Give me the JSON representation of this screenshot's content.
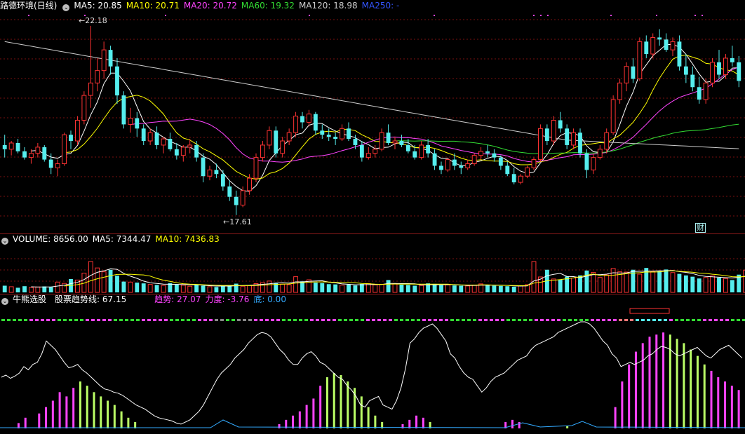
{
  "price_panel": {
    "title": "路德环境(日线)",
    "ma": [
      {
        "label": "MA5: 20.85",
        "color": "#ffffff"
      },
      {
        "label": "MA10: 20.71",
        "color": "#ffff00"
      },
      {
        "label": "MA20: 20.72",
        "color": "#ff44ff"
      },
      {
        "label": "MA60: 19.32",
        "color": "#33dd33"
      },
      {
        "label": "MA120: 18.98",
        "color": "#cccccc"
      },
      {
        "label": "MA250: -",
        "color": "#3355ff"
      }
    ],
    "high_label": "22.18",
    "low_label": "17.61",
    "finance_badge": "财"
  },
  "volume_panel": {
    "items": [
      {
        "label": "VOLUME: 8656.00",
        "color": "#ffffff"
      },
      {
        "label": "MA5: 7344.47",
        "color": "#ffffff"
      },
      {
        "label": "MA10: 7436.83",
        "color": "#ffff00"
      }
    ]
  },
  "indicator_panel": {
    "items": [
      {
        "label": "牛熊选股",
        "color": "#ffffff"
      },
      {
        "label": "股票趋势线: 67.15",
        "color": "#ffffff"
      },
      {
        "label": "趋势: 27.07",
        "color": "#ff44ff"
      },
      {
        "label": "力度: -3.76",
        "color": "#ff44ff"
      },
      {
        "label": "底: 0.00",
        "color": "#33aaff"
      }
    ]
  },
  "colors": {
    "up": "#ff3333",
    "down": "#55eeee",
    "grid": "#7a1010"
  },
  "chart_data": {
    "type": "candlestick",
    "ylim": [
      17.3,
      22.5
    ],
    "candles": [
      [
        19.3,
        19.55,
        19.0,
        19.2
      ],
      [
        19.2,
        19.4,
        19.05,
        19.35
      ],
      [
        19.35,
        19.45,
        19.1,
        19.15
      ],
      [
        19.15,
        19.25,
        18.95,
        19.0
      ],
      [
        19.0,
        19.2,
        18.85,
        19.1
      ],
      [
        19.1,
        19.35,
        19.0,
        19.25
      ],
      [
        19.25,
        19.3,
        18.9,
        18.95
      ],
      [
        18.95,
        19.1,
        18.6,
        18.75
      ],
      [
        18.75,
        18.95,
        18.55,
        18.85
      ],
      [
        18.85,
        19.6,
        18.8,
        19.55
      ],
      [
        19.55,
        19.65,
        19.2,
        19.4
      ],
      [
        19.4,
        20.0,
        19.3,
        19.9
      ],
      [
        19.9,
        20.6,
        19.8,
        20.5
      ],
      [
        20.5,
        22.18,
        20.2,
        20.8
      ],
      [
        20.8,
        21.4,
        20.6,
        21.1
      ],
      [
        21.1,
        21.8,
        20.9,
        21.6
      ],
      [
        21.6,
        21.7,
        21.0,
        21.2
      ],
      [
        21.2,
        21.4,
        20.3,
        20.5
      ],
      [
        20.5,
        20.6,
        19.7,
        19.8
      ],
      [
        19.8,
        20.2,
        19.6,
        19.95
      ],
      [
        19.95,
        20.1,
        19.5,
        19.7
      ],
      [
        19.7,
        19.8,
        19.3,
        19.4
      ],
      [
        19.4,
        19.7,
        19.3,
        19.6
      ],
      [
        19.6,
        19.75,
        19.2,
        19.3
      ],
      [
        19.3,
        19.5,
        19.1,
        19.45
      ],
      [
        19.45,
        19.6,
        19.15,
        19.2
      ],
      [
        19.2,
        19.35,
        18.95,
        19.05
      ],
      [
        19.05,
        19.3,
        18.9,
        19.25
      ],
      [
        19.25,
        19.45,
        19.1,
        19.3
      ],
      [
        19.3,
        19.4,
        18.9,
        19.0
      ],
      [
        19.0,
        19.1,
        18.4,
        18.55
      ],
      [
        18.55,
        18.8,
        18.45,
        18.7
      ],
      [
        18.7,
        18.85,
        18.5,
        18.6
      ],
      [
        18.6,
        18.7,
        18.2,
        18.3
      ],
      [
        18.3,
        18.45,
        17.95,
        18.05
      ],
      [
        18.05,
        18.2,
        17.61,
        17.85
      ],
      [
        17.85,
        18.3,
        17.8,
        18.2
      ],
      [
        18.2,
        18.6,
        18.1,
        18.5
      ],
      [
        18.5,
        19.1,
        18.4,
        19.0
      ],
      [
        19.0,
        19.4,
        18.9,
        19.3
      ],
      [
        19.3,
        19.75,
        19.2,
        19.65
      ],
      [
        19.65,
        19.75,
        19.0,
        19.1
      ],
      [
        19.1,
        19.5,
        19.0,
        19.4
      ],
      [
        19.4,
        19.7,
        19.3,
        19.6
      ],
      [
        19.6,
        20.1,
        19.5,
        20.0
      ],
      [
        20.0,
        20.1,
        19.7,
        19.85
      ],
      [
        19.85,
        20.15,
        19.75,
        20.05
      ],
      [
        20.05,
        20.1,
        19.55,
        19.65
      ],
      [
        19.65,
        19.8,
        19.45,
        19.55
      ],
      [
        19.55,
        19.7,
        19.4,
        19.5
      ],
      [
        19.5,
        19.6,
        19.3,
        19.45
      ],
      [
        19.45,
        19.8,
        19.4,
        19.7
      ],
      [
        19.7,
        19.85,
        19.4,
        19.45
      ],
      [
        19.45,
        19.55,
        19.2,
        19.3
      ],
      [
        19.3,
        19.4,
        18.9,
        19.0
      ],
      [
        19.0,
        19.25,
        18.95,
        19.1
      ],
      [
        19.1,
        19.3,
        19.0,
        19.2
      ],
      [
        19.2,
        19.7,
        19.15,
        19.6
      ],
      [
        19.6,
        19.8,
        19.3,
        19.35
      ],
      [
        19.35,
        19.5,
        19.2,
        19.4
      ],
      [
        19.4,
        19.55,
        19.25,
        19.3
      ],
      [
        19.3,
        19.45,
        19.1,
        19.15
      ],
      [
        19.15,
        19.3,
        18.95,
        19.0
      ],
      [
        19.0,
        19.4,
        18.95,
        19.3
      ],
      [
        19.3,
        19.45,
        19.0,
        19.1
      ],
      [
        19.1,
        19.2,
        18.7,
        18.8
      ],
      [
        18.8,
        18.9,
        18.6,
        18.7
      ],
      [
        18.7,
        19.0,
        18.65,
        18.95
      ],
      [
        18.95,
        19.1,
        18.7,
        18.8
      ],
      [
        18.8,
        18.9,
        18.6,
        18.75
      ],
      [
        18.75,
        18.95,
        18.7,
        18.85
      ],
      [
        18.85,
        19.1,
        18.8,
        19.05
      ],
      [
        19.05,
        19.25,
        18.95,
        19.15
      ],
      [
        19.15,
        19.3,
        19.0,
        19.1
      ],
      [
        19.1,
        19.2,
        18.9,
        19.0
      ],
      [
        19.0,
        19.05,
        18.7,
        18.8
      ],
      [
        18.8,
        18.9,
        18.55,
        18.6
      ],
      [
        18.6,
        18.75,
        18.35,
        18.4
      ],
      [
        18.4,
        18.6,
        18.35,
        18.55
      ],
      [
        18.55,
        18.8,
        18.5,
        18.75
      ],
      [
        18.75,
        19.0,
        18.7,
        18.95
      ],
      [
        18.95,
        19.8,
        18.9,
        19.7
      ],
      [
        19.7,
        19.8,
        19.3,
        19.4
      ],
      [
        19.4,
        20.0,
        19.3,
        19.9
      ],
      [
        19.9,
        20.1,
        19.6,
        19.7
      ],
      [
        19.7,
        19.8,
        19.2,
        19.3
      ],
      [
        19.3,
        19.7,
        19.2,
        19.6
      ],
      [
        19.6,
        19.7,
        19.0,
        19.1
      ],
      [
        19.1,
        19.2,
        18.5,
        18.7
      ],
      [
        18.7,
        19.1,
        18.6,
        19.0
      ],
      [
        19.0,
        19.3,
        18.95,
        19.2
      ],
      [
        19.2,
        19.7,
        19.1,
        19.6
      ],
      [
        19.6,
        20.5,
        19.55,
        20.4
      ],
      [
        20.4,
        20.9,
        20.3,
        20.8
      ],
      [
        20.8,
        21.3,
        20.6,
        21.2
      ],
      [
        21.2,
        21.4,
        20.8,
        20.9
      ],
      [
        20.9,
        21.9,
        20.85,
        21.8
      ],
      [
        21.8,
        21.95,
        21.4,
        21.5
      ],
      [
        21.5,
        22.0,
        21.4,
        21.9
      ],
      [
        21.9,
        22.1,
        21.7,
        21.85
      ],
      [
        21.85,
        22.0,
        21.55,
        21.6
      ],
      [
        21.6,
        21.9,
        21.45,
        21.8
      ],
      [
        21.8,
        21.95,
        21.1,
        21.2
      ],
      [
        21.2,
        21.5,
        20.8,
        21.0
      ],
      [
        21.0,
        21.2,
        20.6,
        20.7
      ],
      [
        20.7,
        20.95,
        20.3,
        20.4
      ],
      [
        20.4,
        20.9,
        20.3,
        20.8
      ],
      [
        20.8,
        21.4,
        20.7,
        21.3
      ],
      [
        21.3,
        21.6,
        20.9,
        21.0
      ],
      [
        21.0,
        21.5,
        20.9,
        21.4
      ],
      [
        21.4,
        21.7,
        21.2,
        21.3
      ],
      [
        21.3,
        21.45,
        20.7,
        20.85
      ]
    ],
    "volume_ylim": [
      0,
      18000
    ],
    "volumes": [
      2600,
      2200,
      1800,
      2400,
      1900,
      2100,
      2300,
      2000,
      4000,
      3500,
      5200,
      4800,
      7500,
      12000,
      9500,
      8000,
      8800,
      6500,
      4200,
      4000,
      3800,
      3500,
      3100,
      2900,
      2700,
      3600,
      3200,
      2800,
      2400,
      3000,
      2600,
      2200,
      2100,
      2500,
      2800,
      3400,
      2400,
      2700,
      3400,
      3800,
      4400,
      3700,
      3200,
      3000,
      6100,
      4300,
      4900,
      3800,
      3600,
      3200,
      3100,
      2800,
      3000,
      2700,
      3300,
      3400,
      2900,
      3100,
      4800,
      3300,
      3000,
      2900,
      2600,
      2700,
      3500,
      3300,
      2800,
      2900,
      2700,
      2600,
      2500,
      2800,
      3300,
      2800,
      2600,
      2500,
      2400,
      2200,
      2600,
      3000,
      12000,
      6000,
      8800,
      5200,
      4900,
      6200,
      5600,
      6600,
      8500,
      7800,
      5800,
      6800,
      9300,
      8000,
      7900,
      8800,
      7100,
      9500,
      8200,
      8400,
      8900,
      7700,
      7200,
      6600,
      6100,
      5400,
      5800,
      6400,
      5700,
      5400,
      4800,
      6900,
      8656
    ],
    "indicator_ylim": [
      0,
      100
    ],
    "trendline": [
      48,
      50,
      47,
      49,
      52,
      58,
      55,
      60,
      62,
      70,
      82,
      78,
      74,
      68,
      62,
      57,
      58,
      60,
      55,
      52,
      48,
      44,
      40,
      37,
      36,
      34,
      33,
      31,
      28,
      25,
      22,
      20,
      18,
      15,
      12,
      10,
      9,
      8,
      7,
      5,
      4,
      6,
      8,
      12,
      16,
      22,
      30,
      38,
      46,
      52,
      56,
      60,
      66,
      70,
      74,
      80,
      84,
      88,
      90,
      89,
      86,
      80,
      74,
      70,
      64,
      60,
      60,
      66,
      70,
      72,
      68,
      62,
      60,
      56,
      52,
      48,
      46,
      40,
      36,
      30,
      22,
      20,
      26,
      28,
      30,
      22,
      20,
      18,
      26,
      38,
      56,
      80,
      84,
      90,
      94,
      96,
      98,
      94,
      88,
      82,
      70,
      66,
      58,
      52,
      48,
      46,
      40,
      34,
      38,
      44,
      48,
      50,
      52,
      56,
      60,
      64,
      66,
      68,
      74,
      78,
      80,
      82,
      84,
      86,
      90,
      92,
      94,
      96,
      98,
      100,
      100,
      98,
      94,
      88,
      82,
      78,
      70,
      66,
      58,
      60,
      62,
      60,
      62,
      64,
      68,
      70,
      74,
      77,
      76,
      74,
      70,
      68,
      70,
      72,
      74,
      76,
      72,
      68,
      66,
      70,
      74,
      76,
      78,
      74,
      70,
      66
    ],
    "bars": [
      0,
      0,
      5,
      10,
      0,
      14,
      20,
      26,
      34,
      30,
      38,
      44,
      40,
      34,
      30,
      26,
      22,
      16,
      10,
      6,
      0,
      0,
      0,
      0,
      0,
      0,
      0,
      0,
      0,
      0,
      0,
      0,
      0,
      0,
      0,
      0,
      0,
      0,
      0,
      0,
      4,
      8,
      12,
      16,
      22,
      28,
      40,
      48,
      52,
      50,
      44,
      38,
      30,
      20,
      12,
      6,
      0,
      0,
      4,
      8,
      12,
      10,
      6,
      0,
      0,
      0,
      0,
      0,
      0,
      0,
      0,
      0,
      0,
      6,
      8,
      6,
      0,
      0,
      0,
      0,
      0,
      0,
      2,
      0,
      0,
      0,
      0,
      0,
      0,
      20,
      44,
      60,
      72,
      80,
      86,
      88,
      90,
      88,
      84,
      80,
      74,
      68,
      60,
      54,
      48,
      44,
      40,
      36
    ],
    "bar_colors": [
      "m",
      "m",
      "m",
      "m",
      "m",
      "m",
      "m",
      "m",
      "m",
      "m",
      "m",
      "g",
      "g",
      "g",
      "g",
      "g",
      "g",
      "g",
      "g",
      "g",
      "g",
      "g",
      "g",
      "g",
      "g",
      "g",
      "g",
      "g",
      "g",
      "g",
      "g",
      "g",
      "g",
      "g",
      "g",
      "g",
      "g",
      "g",
      "g",
      "g",
      "m",
      "m",
      "m",
      "m",
      "m",
      "m",
      "m",
      "g",
      "g",
      "g",
      "g",
      "g",
      "g",
      "g",
      "g",
      "g",
      "g",
      "g",
      "m",
      "m",
      "m",
      "m",
      "g",
      "g",
      "g",
      "g",
      "g",
      "g",
      "g",
      "g",
      "g",
      "g",
      "g",
      "m",
      "m",
      "m",
      "m",
      "g",
      "g",
      "g",
      "g",
      "g",
      "g",
      "g",
      "g",
      "g",
      "g",
      "g",
      "g",
      "m",
      "m",
      "m",
      "m",
      "m",
      "m",
      "m",
      "m",
      "g",
      "g",
      "g",
      "g",
      "g",
      "g",
      "m",
      "m",
      "m",
      "m",
      "m"
    ]
  }
}
